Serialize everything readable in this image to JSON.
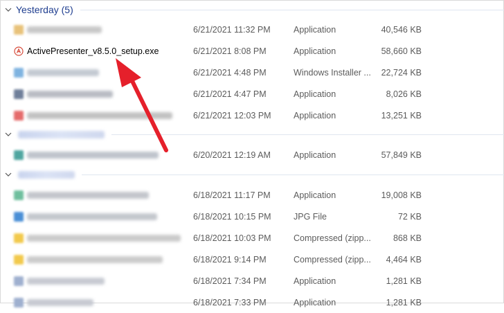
{
  "groups": [
    {
      "title": "Yesterday (5)",
      "icon": "chevron-down-icon"
    },
    {
      "title": "",
      "icon": "chevron-down-icon"
    },
    {
      "title": "",
      "icon": "chevron-down-icon"
    }
  ],
  "files": [
    {
      "name": "",
      "date": "6/21/2021 11:32 PM",
      "type": "Application",
      "size": "40,546 KB",
      "icon": "app-icon",
      "color": "#e8c27a"
    },
    {
      "name": "ActivePresenter_v8.5.0_setup.exe",
      "date": "6/21/2021 8:08 PM",
      "type": "Application",
      "size": "58,660 KB",
      "icon": "activepresenter-icon",
      "color": "#d64a3a"
    },
    {
      "name": "",
      "date": "6/21/2021 4:48 PM",
      "type": "Windows Installer ...",
      "size": "22,724 KB",
      "icon": "installer-icon",
      "color": "#7fb3e0"
    },
    {
      "name": "",
      "date": "6/21/2021 4:47 PM",
      "type": "Application",
      "size": "8,026 KB",
      "icon": "app-icon",
      "color": "#6f7f9a"
    },
    {
      "name": "",
      "date": "6/21/2021 12:03 PM",
      "type": "Application",
      "size": "13,251 KB",
      "icon": "app-icon",
      "color": "#e56b6b"
    },
    {
      "name": "",
      "date": "6/20/2021 12:19 AM",
      "type": "Application",
      "size": "57,849 KB",
      "icon": "app-icon",
      "color": "#4fa6a0"
    },
    {
      "name": "",
      "date": "6/18/2021 11:17 PM",
      "type": "Application",
      "size": "19,008 KB",
      "icon": "app-icon",
      "color": "#6fbf9e"
    },
    {
      "name": "",
      "date": "6/18/2021 10:15 PM",
      "type": "JPG File",
      "size": "72 KB",
      "icon": "image-icon",
      "color": "#4a8fd6"
    },
    {
      "name": "",
      "date": "6/18/2021 10:03 PM",
      "type": "Compressed (zipp...",
      "size": "868 KB",
      "icon": "zip-folder-icon",
      "color": "#f2c94c"
    },
    {
      "name": "",
      "date": "6/18/2021 9:14 PM",
      "type": "Compressed (zipp...",
      "size": "4,464 KB",
      "icon": "zip-folder-icon",
      "color": "#f2c94c"
    },
    {
      "name": "",
      "date": "6/18/2021 7:34 PM",
      "type": "Application",
      "size": "1,281 KB",
      "icon": "app-icon",
      "color": "#9fb0cf"
    },
    {
      "name": "",
      "date": "6/18/2021 7:33 PM",
      "type": "Application",
      "size": "1,281 KB",
      "icon": "app-icon",
      "color": "#9fb0cf"
    }
  ],
  "annotation": {
    "color": "#e5202b"
  }
}
